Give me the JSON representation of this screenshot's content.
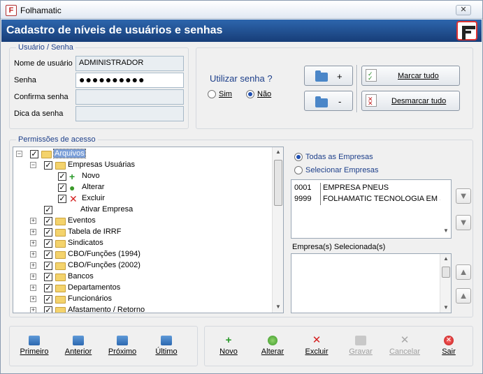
{
  "window": {
    "title": "Folhamatic",
    "close_glyph": "✕",
    "header_title": "Cadastro de níveis de usuários e senhas"
  },
  "user_section": {
    "label": "Usuário / Senha",
    "username_label": "Nome de usuário",
    "username_value": "ADMINISTRADOR",
    "password_label": "Senha",
    "password_value": "●●●●●●●●●●",
    "confirm_label": "Confirma senha",
    "confirm_value": "",
    "hint_label": "Dica da senha",
    "hint_value": ""
  },
  "options": {
    "question": "Utilizar senha ?",
    "yes_label": "Sim",
    "no_label": "Não",
    "selected": "Não",
    "plus_label": "+",
    "minus_label": "-",
    "mark_all_label": "Marcar tudo",
    "unmark_all_label": "Desmarcar tudo"
  },
  "permissions": {
    "label": "Permissões de acesso",
    "tree": [
      {
        "label": "Arquivos",
        "level": 0,
        "expander": "⊟",
        "checked": true,
        "icon": "folder-icon",
        "selected": true
      },
      {
        "label": "Empresas Usuárias",
        "level": 1,
        "expander": "⊟",
        "checked": true,
        "icon": "folder-icon"
      },
      {
        "label": "Novo",
        "level": 2,
        "expander": "",
        "checked": true,
        "icon": "add-icon"
      },
      {
        "label": "Alterar",
        "level": 2,
        "expander": "",
        "checked": true,
        "icon": "edit-icon"
      },
      {
        "label": "Excluir",
        "level": 2,
        "expander": "",
        "checked": true,
        "icon": "delete-icon"
      },
      {
        "label": "Ativar Empresa",
        "level": 1,
        "expander": "",
        "checked": true,
        "icon": ""
      },
      {
        "label": "Eventos",
        "level": 1,
        "expander": "⊞",
        "checked": true,
        "icon": "folder-icon"
      },
      {
        "label": "Tabela de IRRF",
        "level": 1,
        "expander": "⊞",
        "checked": true,
        "icon": "folder-icon"
      },
      {
        "label": "Sindicatos",
        "level": 1,
        "expander": "⊞",
        "checked": true,
        "icon": "folder-icon"
      },
      {
        "label": "CBO/Funções (1994)",
        "level": 1,
        "expander": "⊞",
        "checked": true,
        "icon": "folder-icon"
      },
      {
        "label": "CBO/Funções (2002)",
        "level": 1,
        "expander": "⊞",
        "checked": true,
        "icon": "folder-icon"
      },
      {
        "label": "Bancos",
        "level": 1,
        "expander": "⊞",
        "checked": true,
        "icon": "folder-icon"
      },
      {
        "label": "Departamentos",
        "level": 1,
        "expander": "⊞",
        "checked": true,
        "icon": "folder-icon"
      },
      {
        "label": "Funcionários",
        "level": 1,
        "expander": "⊞",
        "checked": true,
        "icon": "folder-icon"
      },
      {
        "label": "Afastamento / Retorno",
        "level": 1,
        "expander": "⊞",
        "checked": true,
        "icon": "folder-icon"
      }
    ]
  },
  "companies": {
    "all_label": "Todas as Empresas",
    "select_label": "Selecionar Empresas",
    "selected_option": "Todas as Empresas",
    "rows": [
      {
        "code": "0001",
        "name": "EMPRESA PNEUS"
      },
      {
        "code": "9999",
        "name": "FOLHAMATIC TECNOLOGIA EM SI:"
      }
    ],
    "selected_label": "Empresa(s) Selecionada(s)"
  },
  "navigation": {
    "first": "Primeiro",
    "previous": "Anterior",
    "next": "Próximo",
    "last": "Último"
  },
  "actions": {
    "new": "Novo",
    "edit": "Alterar",
    "delete": "Excluir",
    "save": "Gravar",
    "cancel": "Cancelar",
    "exit": "Sair"
  },
  "colors": {
    "header_bg": "#1f4d8f",
    "group_label": "#1d3f8a",
    "selection": "#7b9fd8"
  }
}
